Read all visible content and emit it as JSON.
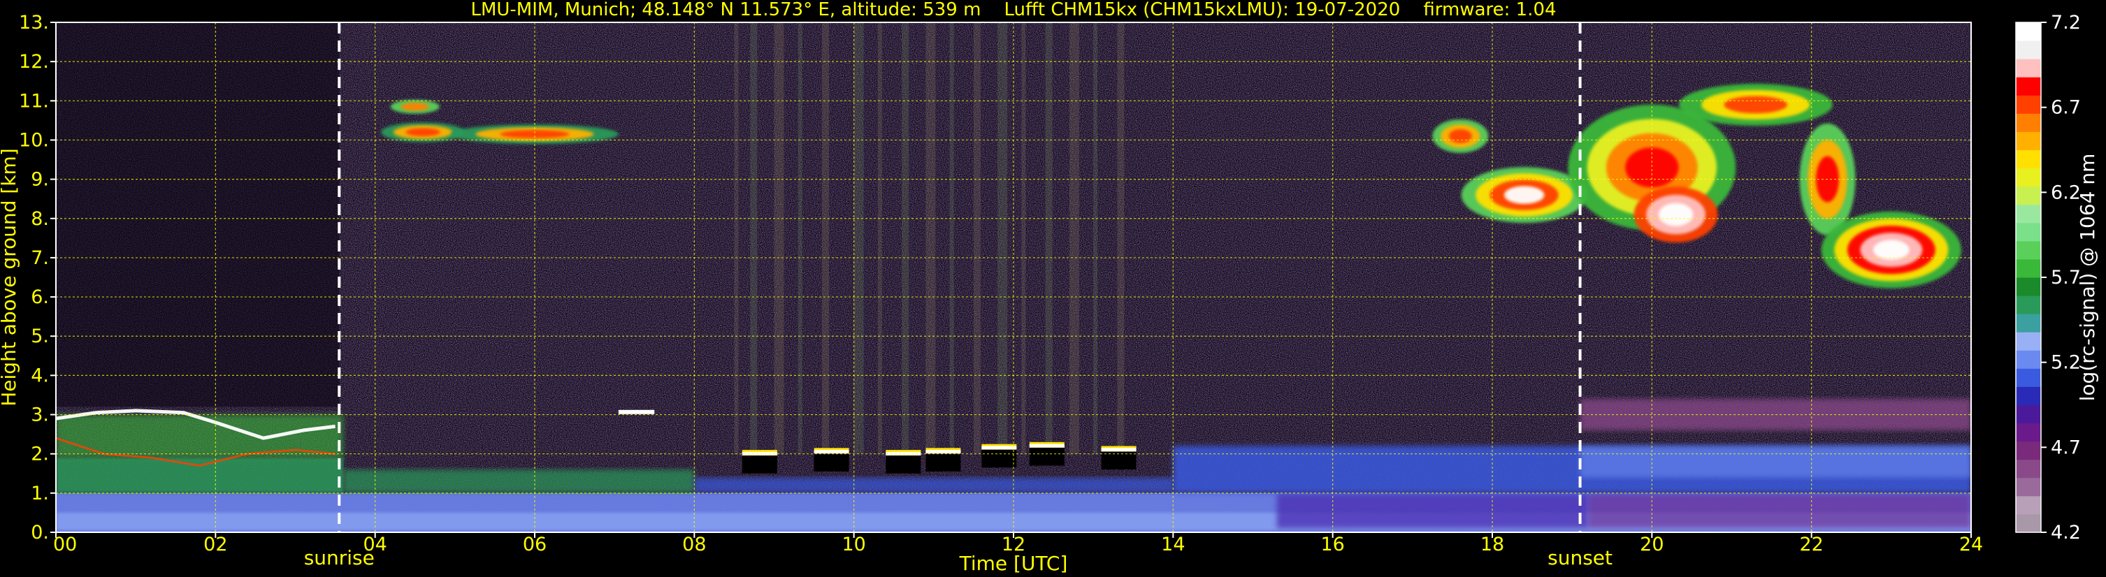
{
  "chart_data": {
    "type": "heatmap",
    "title": "LMU-MIM, Munich; 48.148° N 11.573° E, altitude: 539 m    Lufft CHM15kx (CHM15kxLMU): 19-07-2020    firmware: 1.04",
    "xlabel": "Time [UTC]",
    "ylabel": "Height above ground [km]",
    "xlim": [
      0,
      24
    ],
    "ylim": [
      0,
      13
    ],
    "x_ticks": [
      0,
      2,
      4,
      6,
      8,
      10,
      12,
      14,
      16,
      18,
      20,
      22,
      24
    ],
    "x_tick_labels": [
      "00",
      "02",
      "04",
      "06",
      "08",
      "10",
      "12",
      "14",
      "16",
      "18",
      "20",
      "22",
      "24"
    ],
    "y_ticks": [
      0,
      1,
      2,
      3,
      4,
      5,
      6,
      7,
      8,
      9,
      10,
      11,
      12,
      13
    ],
    "y_tick_labels": [
      "0.",
      "1.",
      "2.",
      "3.",
      "4.",
      "5.",
      "6.",
      "7.",
      "8.",
      "9.",
      "10.",
      "11.",
      "12.",
      "13."
    ],
    "grid": true,
    "annotations": [
      {
        "label": "sunrise",
        "x": 3.55
      },
      {
        "label": "sunset",
        "x": 19.1
      }
    ],
    "colorbar": {
      "label": "log(rc-signal) @ 1064 nm",
      "min": 4.2,
      "max": 7.2,
      "ticks": [
        4.2,
        4.7,
        5.2,
        5.7,
        6.2,
        6.7,
        7.2
      ],
      "tick_labels": [
        "4.2",
        "4.7",
        "5.2",
        "5.7",
        "6.2",
        "6.7",
        "7.2"
      ],
      "colors": [
        "#a898a8",
        "#b8a0b8",
        "#9a6a9a",
        "#8a4a8a",
        "#7a2a7a",
        "#6a1a8a",
        "#4a1a9a",
        "#2a2ab8",
        "#3a5ae0",
        "#6a8af0",
        "#9ab0f5",
        "#3aa0a0",
        "#2a9a5a",
        "#1a8a2a",
        "#3ab83a",
        "#5ad05a",
        "#7ae08a",
        "#9ae8a0",
        "#c8f050",
        "#e8f020",
        "#ffe000",
        "#ffb000",
        "#ff8000",
        "#ff4000",
        "#ff0000",
        "#ffc0c0",
        "#f0f0f0",
        "#ffffff"
      ]
    },
    "features": [
      {
        "type": "aerosol_layer",
        "x_range": [
          0,
          24
        ],
        "top_km": 1.0
      },
      {
        "type": "boundary_layer",
        "x_range": [
          0,
          3.6
        ],
        "top_km": 3.0
      },
      {
        "type": "cloud",
        "x_range": [
          4.0,
          6.8
        ],
        "height_km": [
          10.0,
          10.8
        ]
      },
      {
        "type": "cloud",
        "x_range": [
          7.0,
          7.5
        ],
        "height_km": [
          3.0,
          3.1
        ]
      },
      {
        "type": "cloud",
        "x_range": [
          8.4,
          13.4
        ],
        "height_km": [
          1.5,
          2.1
        ]
      },
      {
        "type": "cloud",
        "x_range": [
          17.3,
          19.3
        ],
        "height_km": [
          7.8,
          10.3
        ]
      },
      {
        "type": "cloud",
        "x_range": [
          19.3,
          21.6
        ],
        "height_km": [
          7.0,
          11.2
        ]
      },
      {
        "type": "cloud",
        "x_range": [
          21.8,
          23.4
        ],
        "height_km": [
          6.2,
          11.3
        ]
      },
      {
        "type": "aerosol_layer",
        "x_range": [
          19.1,
          24
        ],
        "height_km": [
          2.8,
          3.4
        ]
      }
    ]
  }
}
